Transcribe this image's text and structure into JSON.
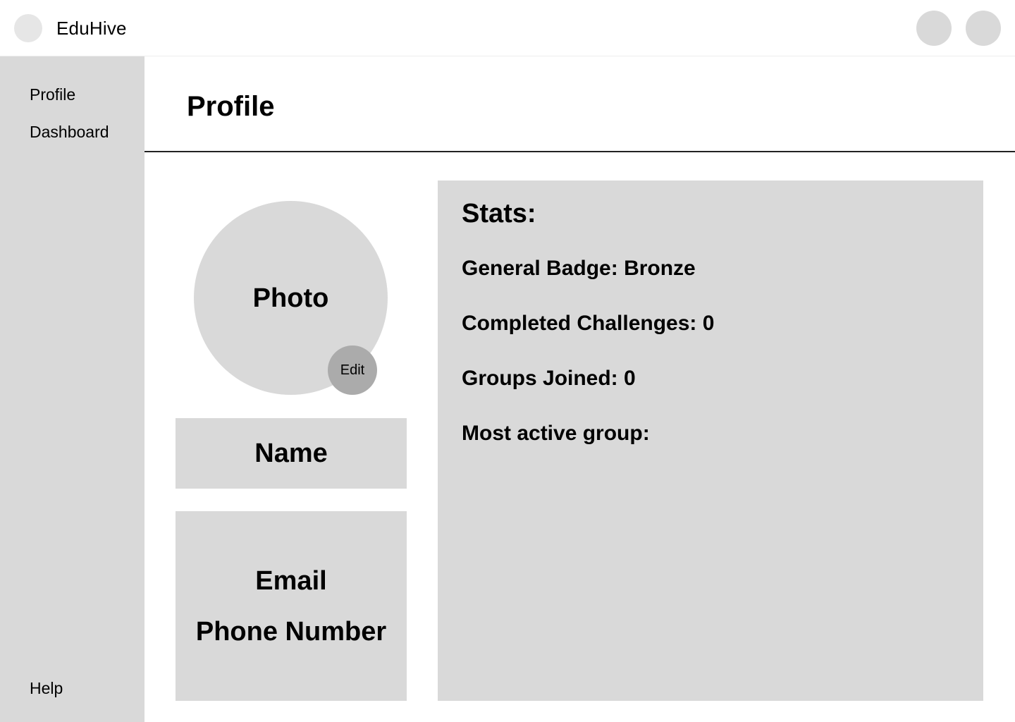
{
  "app": {
    "title": "EduHive"
  },
  "sidebar": {
    "items": [
      {
        "label": "Profile"
      },
      {
        "label": "Dashboard"
      }
    ],
    "help_label": "Help"
  },
  "page": {
    "title": "Profile"
  },
  "profile": {
    "photo_label": "Photo",
    "edit_label": "Edit",
    "name_label": "Name",
    "email_label": "Email",
    "phone_label": "Phone Number"
  },
  "stats": {
    "title": "Stats:",
    "lines": [
      "General Badge: Bronze",
      "Completed Challenges: 0",
      "Groups Joined: 0",
      "Most active group:"
    ]
  }
}
